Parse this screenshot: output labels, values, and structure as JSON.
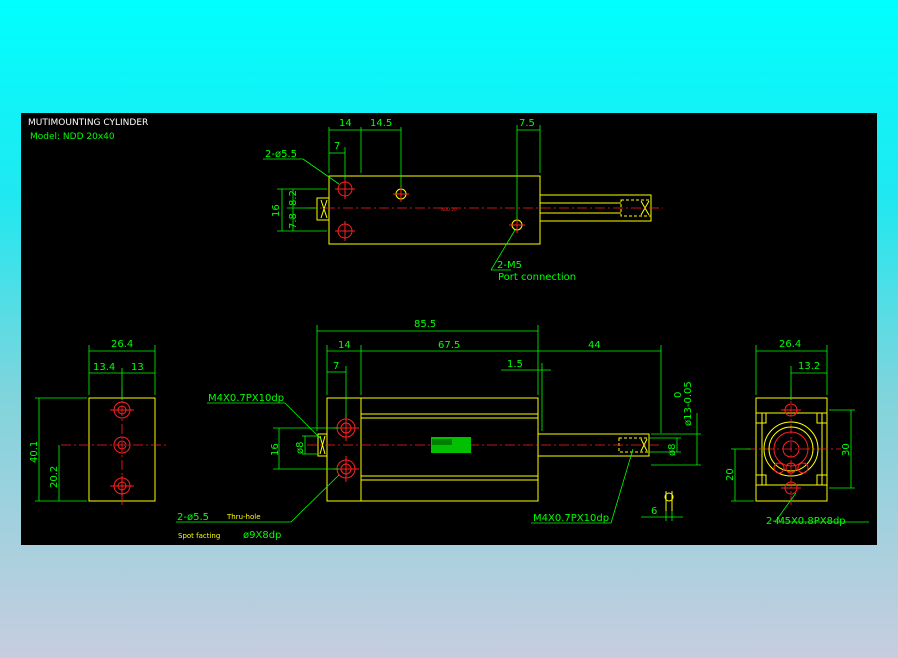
{
  "title": "MUTIMOUNTING CYLINDER",
  "model": "Model: NDD 20x40",
  "colors": {
    "background_gradient_top": "#00ffff",
    "background_gradient_bottom": "#c6cde0",
    "panel": "#000000",
    "dimension": "#00ff00",
    "outline": "#ffff00",
    "centerline": "#ff2020",
    "title": "#ffffff"
  },
  "top_view": {
    "dims": {
      "d14": "14",
      "d14_5": "14.5",
      "d7_5": "7.5",
      "d7": "7",
      "d16": "16",
      "d7_8": "7.8",
      "d8_2": "8.2"
    },
    "hole_note": "2-ø5.5",
    "port_note": "2-M5",
    "port_label": "Port connection"
  },
  "front_view": {
    "dims": {
      "d85_5": "85.5",
      "d14": "14",
      "d67_5": "67.5",
      "d44": "44",
      "d7": "7",
      "d1_5": "1.5",
      "d16": "16",
      "d_phi8_left": "ø8",
      "d_phi8_right": "ø8",
      "d_phi13": "ø13-0.05",
      "d_tol0": "0",
      "d6": "6"
    },
    "thread_left": "M4X0.7PX10dp",
    "thread_right": "M4X0.7PX10dp",
    "hole_note": "2-ø5.5",
    "thru_note": "Thru-hole",
    "spot_label": "Spot facting",
    "spot_dim": "ø9X8dp"
  },
  "left_view": {
    "dims": {
      "d26_4": "26.4",
      "d13_4": "13.4",
      "d13": "13",
      "d40_1": "40.1",
      "d20_2": "20.2"
    }
  },
  "right_view": {
    "dims": {
      "d26_4": "26.4",
      "d13_2": "13.2",
      "d30": "30",
      "d20": "20"
    },
    "thread_note": "2-M5X0.8PX8dp"
  }
}
